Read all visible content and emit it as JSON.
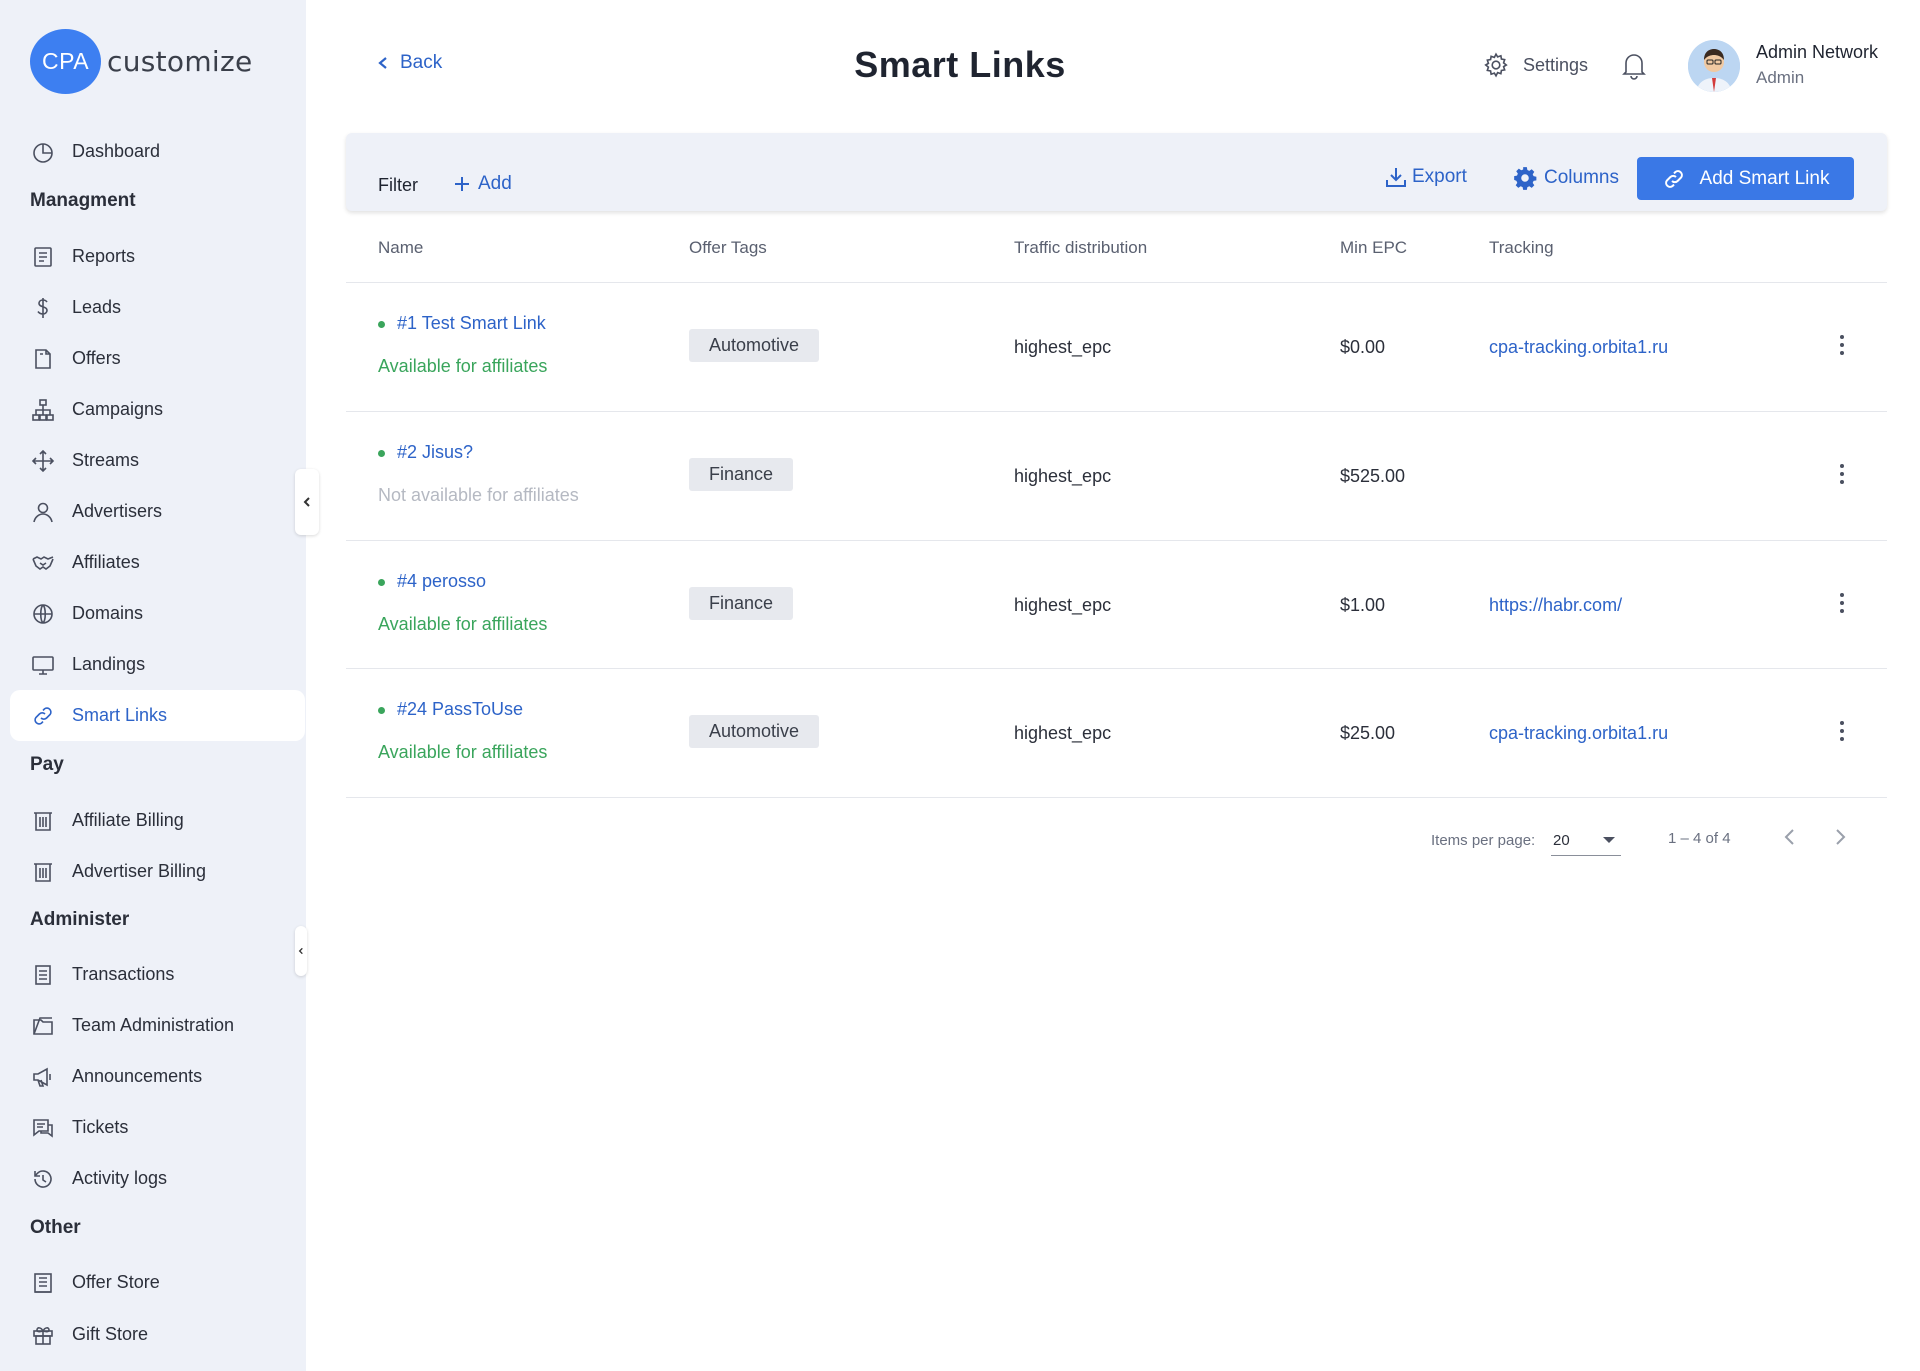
{
  "app": {
    "logo_badge": "CPA",
    "logo_text": "customize"
  },
  "sidebar": {
    "dashboard": "Dashboard",
    "sections": [
      "Managment",
      "Pay",
      "Administer",
      "Other"
    ],
    "managment_items": [
      "Reports",
      "Leads",
      "Offers",
      "Campaigns",
      "Streams",
      "Advertisers",
      "Affiliates",
      "Domains",
      "Landings",
      "Smart Links"
    ],
    "pay_items": [
      "Affiliate Billing",
      "Advertiser Billing"
    ],
    "administer_items": [
      "Transactions",
      "Team Administration",
      "Announcements",
      "Tickets",
      "Activity logs"
    ],
    "other_items": [
      "Offer Store",
      "Gift Store"
    ],
    "active_item": "Smart Links"
  },
  "header": {
    "back_label": "Back",
    "title": "Smart Links",
    "settings_label": "Settings",
    "user_name": "Admin Network",
    "user_role": "Admin"
  },
  "toolbar": {
    "filter_label": "Filter",
    "add_label": "Add",
    "export_label": "Export",
    "columns_label": "Columns",
    "primary_label": "Add Smart Link"
  },
  "table": {
    "headers": [
      "Name",
      "Offer Tags",
      "Traffic distribution",
      "Min EPC",
      "Tracking"
    ],
    "rows": [
      {
        "name": "#1 Test Smart Link",
        "availability": "Available for affiliates",
        "available": true,
        "tag": "Automotive",
        "traffic": "highest_epc",
        "min_epc": "$0.00",
        "tracking": "cpa-tracking.orbita1.ru"
      },
      {
        "name": "#2 Jisus?",
        "availability": "Not available for affiliates",
        "available": false,
        "tag": "Finance",
        "traffic": "highest_epc",
        "min_epc": "$525.00",
        "tracking": ""
      },
      {
        "name": "#4 perosso",
        "availability": "Available for affiliates",
        "available": true,
        "tag": "Finance",
        "traffic": "highest_epc",
        "min_epc": "$1.00",
        "tracking": "https://habr.com/"
      },
      {
        "name": "#24 PassToUse",
        "availability": "Available for affiliates",
        "available": true,
        "tag": "Automotive",
        "traffic": "highest_epc",
        "min_epc": "$25.00",
        "tracking": "cpa-tracking.orbita1.ru"
      }
    ]
  },
  "pagination": {
    "items_per_page_label": "Items per page:",
    "items_per_page_value": "20",
    "range_label": "1 – 4 of 4"
  },
  "colors": {
    "accent": "#3a78e6",
    "link": "#2d63c8",
    "available": "#3aa55c",
    "sidebar_bg": "#eef1f8"
  }
}
